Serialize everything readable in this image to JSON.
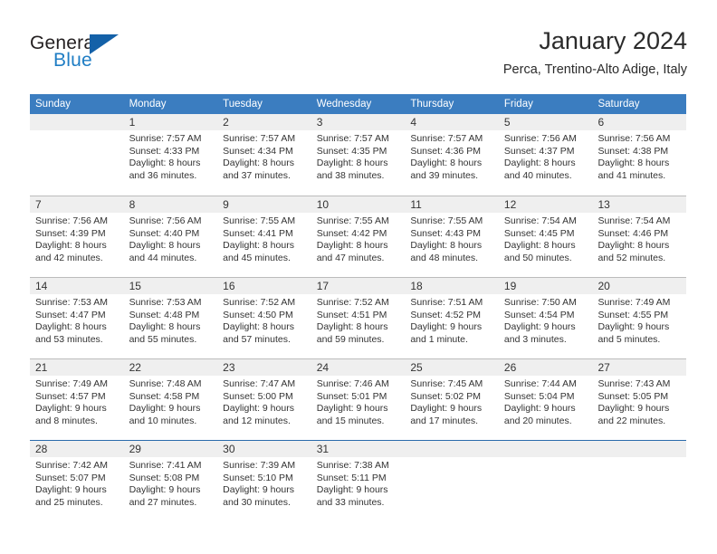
{
  "logo": {
    "word_one": "General",
    "word_two": "Blue",
    "icon": "triangle-icon",
    "colors": {
      "general": "#231f20",
      "blue": "#1f7dc4",
      "triangle": "#1461a8"
    }
  },
  "header": {
    "title": "January 2024",
    "subtitle": "Perca, Trentino-Alto Adige, Italy"
  },
  "colors": {
    "header_bar": "#3b7dc0",
    "day_band": "#efefef",
    "grid_line": "#bcbcbc",
    "text": "#333333"
  },
  "weekdays": [
    "Sunday",
    "Monday",
    "Tuesday",
    "Wednesday",
    "Thursday",
    "Friday",
    "Saturday"
  ],
  "weeks": [
    [
      {
        "day": "",
        "sunrise": "",
        "sunset": "",
        "daylight_line1": "",
        "daylight_line2": ""
      },
      {
        "day": "1",
        "sunrise": "Sunrise: 7:57 AM",
        "sunset": "Sunset: 4:33 PM",
        "daylight_line1": "Daylight: 8 hours",
        "daylight_line2": "and 36 minutes."
      },
      {
        "day": "2",
        "sunrise": "Sunrise: 7:57 AM",
        "sunset": "Sunset: 4:34 PM",
        "daylight_line1": "Daylight: 8 hours",
        "daylight_line2": "and 37 minutes."
      },
      {
        "day": "3",
        "sunrise": "Sunrise: 7:57 AM",
        "sunset": "Sunset: 4:35 PM",
        "daylight_line1": "Daylight: 8 hours",
        "daylight_line2": "and 38 minutes."
      },
      {
        "day": "4",
        "sunrise": "Sunrise: 7:57 AM",
        "sunset": "Sunset: 4:36 PM",
        "daylight_line1": "Daylight: 8 hours",
        "daylight_line2": "and 39 minutes."
      },
      {
        "day": "5",
        "sunrise": "Sunrise: 7:56 AM",
        "sunset": "Sunset: 4:37 PM",
        "daylight_line1": "Daylight: 8 hours",
        "daylight_line2": "and 40 minutes."
      },
      {
        "day": "6",
        "sunrise": "Sunrise: 7:56 AM",
        "sunset": "Sunset: 4:38 PM",
        "daylight_line1": "Daylight: 8 hours",
        "daylight_line2": "and 41 minutes."
      }
    ],
    [
      {
        "day": "7",
        "sunrise": "Sunrise: 7:56 AM",
        "sunset": "Sunset: 4:39 PM",
        "daylight_line1": "Daylight: 8 hours",
        "daylight_line2": "and 42 minutes."
      },
      {
        "day": "8",
        "sunrise": "Sunrise: 7:56 AM",
        "sunset": "Sunset: 4:40 PM",
        "daylight_line1": "Daylight: 8 hours",
        "daylight_line2": "and 44 minutes."
      },
      {
        "day": "9",
        "sunrise": "Sunrise: 7:55 AM",
        "sunset": "Sunset: 4:41 PM",
        "daylight_line1": "Daylight: 8 hours",
        "daylight_line2": "and 45 minutes."
      },
      {
        "day": "10",
        "sunrise": "Sunrise: 7:55 AM",
        "sunset": "Sunset: 4:42 PM",
        "daylight_line1": "Daylight: 8 hours",
        "daylight_line2": "and 47 minutes."
      },
      {
        "day": "11",
        "sunrise": "Sunrise: 7:55 AM",
        "sunset": "Sunset: 4:43 PM",
        "daylight_line1": "Daylight: 8 hours",
        "daylight_line2": "and 48 minutes."
      },
      {
        "day": "12",
        "sunrise": "Sunrise: 7:54 AM",
        "sunset": "Sunset: 4:45 PM",
        "daylight_line1": "Daylight: 8 hours",
        "daylight_line2": "and 50 minutes."
      },
      {
        "day": "13",
        "sunrise": "Sunrise: 7:54 AM",
        "sunset": "Sunset: 4:46 PM",
        "daylight_line1": "Daylight: 8 hours",
        "daylight_line2": "and 52 minutes."
      }
    ],
    [
      {
        "day": "14",
        "sunrise": "Sunrise: 7:53 AM",
        "sunset": "Sunset: 4:47 PM",
        "daylight_line1": "Daylight: 8 hours",
        "daylight_line2": "and 53 minutes."
      },
      {
        "day": "15",
        "sunrise": "Sunrise: 7:53 AM",
        "sunset": "Sunset: 4:48 PM",
        "daylight_line1": "Daylight: 8 hours",
        "daylight_line2": "and 55 minutes."
      },
      {
        "day": "16",
        "sunrise": "Sunrise: 7:52 AM",
        "sunset": "Sunset: 4:50 PM",
        "daylight_line1": "Daylight: 8 hours",
        "daylight_line2": "and 57 minutes."
      },
      {
        "day": "17",
        "sunrise": "Sunrise: 7:52 AM",
        "sunset": "Sunset: 4:51 PM",
        "daylight_line1": "Daylight: 8 hours",
        "daylight_line2": "and 59 minutes."
      },
      {
        "day": "18",
        "sunrise": "Sunrise: 7:51 AM",
        "sunset": "Sunset: 4:52 PM",
        "daylight_line1": "Daylight: 9 hours",
        "daylight_line2": "and 1 minute."
      },
      {
        "day": "19",
        "sunrise": "Sunrise: 7:50 AM",
        "sunset": "Sunset: 4:54 PM",
        "daylight_line1": "Daylight: 9 hours",
        "daylight_line2": "and 3 minutes."
      },
      {
        "day": "20",
        "sunrise": "Sunrise: 7:49 AM",
        "sunset": "Sunset: 4:55 PM",
        "daylight_line1": "Daylight: 9 hours",
        "daylight_line2": "and 5 minutes."
      }
    ],
    [
      {
        "day": "21",
        "sunrise": "Sunrise: 7:49 AM",
        "sunset": "Sunset: 4:57 PM",
        "daylight_line1": "Daylight: 9 hours",
        "daylight_line2": "and 8 minutes."
      },
      {
        "day": "22",
        "sunrise": "Sunrise: 7:48 AM",
        "sunset": "Sunset: 4:58 PM",
        "daylight_line1": "Daylight: 9 hours",
        "daylight_line2": "and 10 minutes."
      },
      {
        "day": "23",
        "sunrise": "Sunrise: 7:47 AM",
        "sunset": "Sunset: 5:00 PM",
        "daylight_line1": "Daylight: 9 hours",
        "daylight_line2": "and 12 minutes."
      },
      {
        "day": "24",
        "sunrise": "Sunrise: 7:46 AM",
        "sunset": "Sunset: 5:01 PM",
        "daylight_line1": "Daylight: 9 hours",
        "daylight_line2": "and 15 minutes."
      },
      {
        "day": "25",
        "sunrise": "Sunrise: 7:45 AM",
        "sunset": "Sunset: 5:02 PM",
        "daylight_line1": "Daylight: 9 hours",
        "daylight_line2": "and 17 minutes."
      },
      {
        "day": "26",
        "sunrise": "Sunrise: 7:44 AM",
        "sunset": "Sunset: 5:04 PM",
        "daylight_line1": "Daylight: 9 hours",
        "daylight_line2": "and 20 minutes."
      },
      {
        "day": "27",
        "sunrise": "Sunrise: 7:43 AM",
        "sunset": "Sunset: 5:05 PM",
        "daylight_line1": "Daylight: 9 hours",
        "daylight_line2": "and 22 minutes."
      }
    ],
    [
      {
        "day": "28",
        "sunrise": "Sunrise: 7:42 AM",
        "sunset": "Sunset: 5:07 PM",
        "daylight_line1": "Daylight: 9 hours",
        "daylight_line2": "and 25 minutes."
      },
      {
        "day": "29",
        "sunrise": "Sunrise: 7:41 AM",
        "sunset": "Sunset: 5:08 PM",
        "daylight_line1": "Daylight: 9 hours",
        "daylight_line2": "and 27 minutes."
      },
      {
        "day": "30",
        "sunrise": "Sunrise: 7:39 AM",
        "sunset": "Sunset: 5:10 PM",
        "daylight_line1": "Daylight: 9 hours",
        "daylight_line2": "and 30 minutes."
      },
      {
        "day": "31",
        "sunrise": "Sunrise: 7:38 AM",
        "sunset": "Sunset: 5:11 PM",
        "daylight_line1": "Daylight: 9 hours",
        "daylight_line2": "and 33 minutes."
      },
      {
        "day": "",
        "sunrise": "",
        "sunset": "",
        "daylight_line1": "",
        "daylight_line2": ""
      },
      {
        "day": "",
        "sunrise": "",
        "sunset": "",
        "daylight_line1": "",
        "daylight_line2": ""
      },
      {
        "day": "",
        "sunrise": "",
        "sunset": "",
        "daylight_line1": "",
        "daylight_line2": ""
      }
    ]
  ]
}
